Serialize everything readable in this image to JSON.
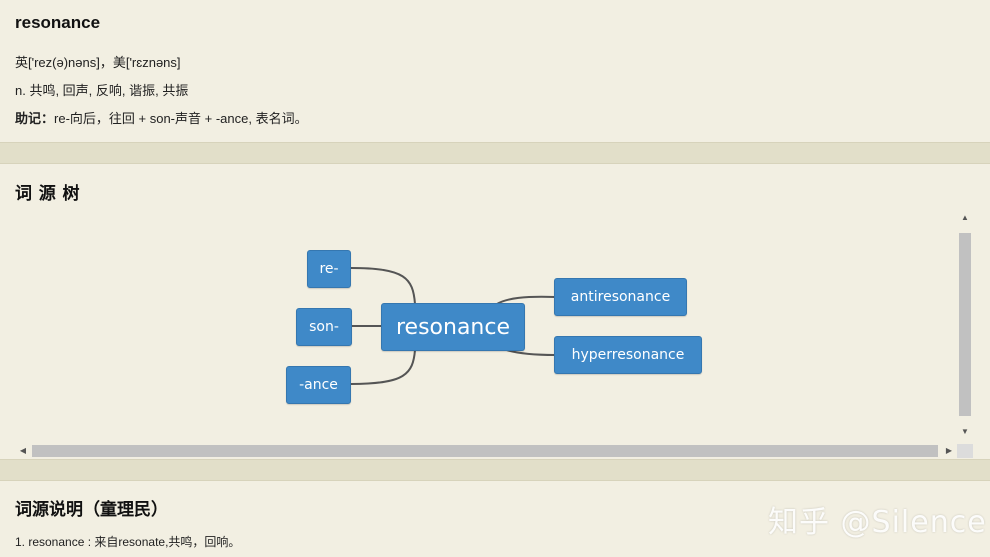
{
  "word": {
    "title": "resonance",
    "pronunciation": "英['rez(ə)nəns]，美['rɛznəns]",
    "definition": "n. 共鸣, 回声, 反响, 谐振, 共振",
    "mnemonic_label": "助记：",
    "mnemonic_text": "re-向后，往回 + son-声音 + -ance, 表名词。"
  },
  "etymology_tree": {
    "title": "词 源 树",
    "root": "resonance",
    "prefix_nodes": [
      "re-",
      "son-",
      "-ance"
    ],
    "derived_nodes": [
      "antiresonance",
      "hyperresonance"
    ],
    "colors": {
      "node_bg": "#3f89c8",
      "node_text": "#ffffff",
      "link": "#555555"
    }
  },
  "etymology_notes": {
    "title": "词源说明（童理民）",
    "items": [
      "1. resonance : 来自resonate,共鸣，回响。"
    ]
  },
  "watermark": "知乎 @Silence",
  "scrollbar": {
    "up_icon": "triangle-up-icon",
    "down_icon": "triangle-down-icon",
    "left_icon": "triangle-left-icon",
    "right_icon": "triangle-right-icon"
  }
}
